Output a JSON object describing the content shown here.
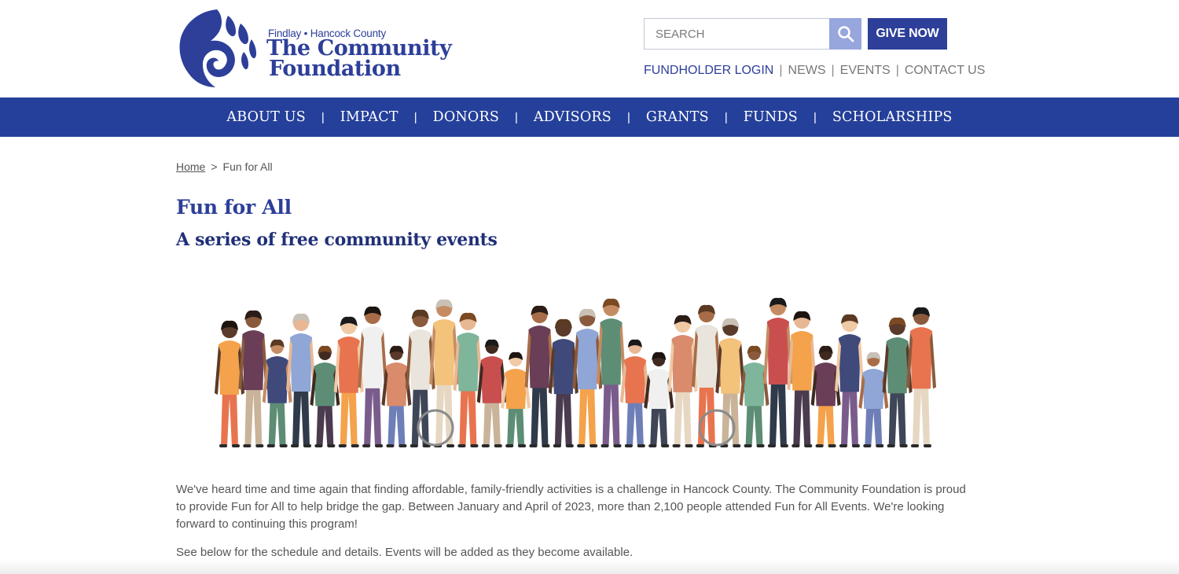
{
  "logo": {
    "tagline": "Findlay • Hancock County",
    "name_line1": "The Community",
    "name_line2": "Foundation"
  },
  "search": {
    "placeholder": "SEARCH"
  },
  "give_button": "GIVE NOW",
  "utility_links": [
    "FUNDHOLDER LOGIN",
    "NEWS",
    "EVENTS",
    "CONTACT US"
  ],
  "nav": [
    "ABOUT US",
    "IMPACT",
    "DONORS",
    "ADVISORS",
    "GRANTS",
    "FUNDS",
    "SCHOLARSHIPS"
  ],
  "nav_separator": "|",
  "breadcrumb": {
    "home": "Home",
    "separator": ">",
    "current": "Fun for All"
  },
  "page": {
    "title": "Fun for All",
    "subtitle": "A series of free community events",
    "paragraph1": "We've heard time and time again that finding affordable, family-friendly activities is a challenge in Hancock County. The Community Foundation is proud to provide Fun for All to help bridge the gap. Between January and April of 2023, more than 2,100 people attended Fun for All Events. We're looking forward to continuing this program!",
    "paragraph2": "See below for the schedule and details. Events will be added as they become available."
  },
  "colors": {
    "brand_blue": "#2d3f99",
    "nav_blue": "#25409a",
    "search_button": "#98a6de"
  }
}
